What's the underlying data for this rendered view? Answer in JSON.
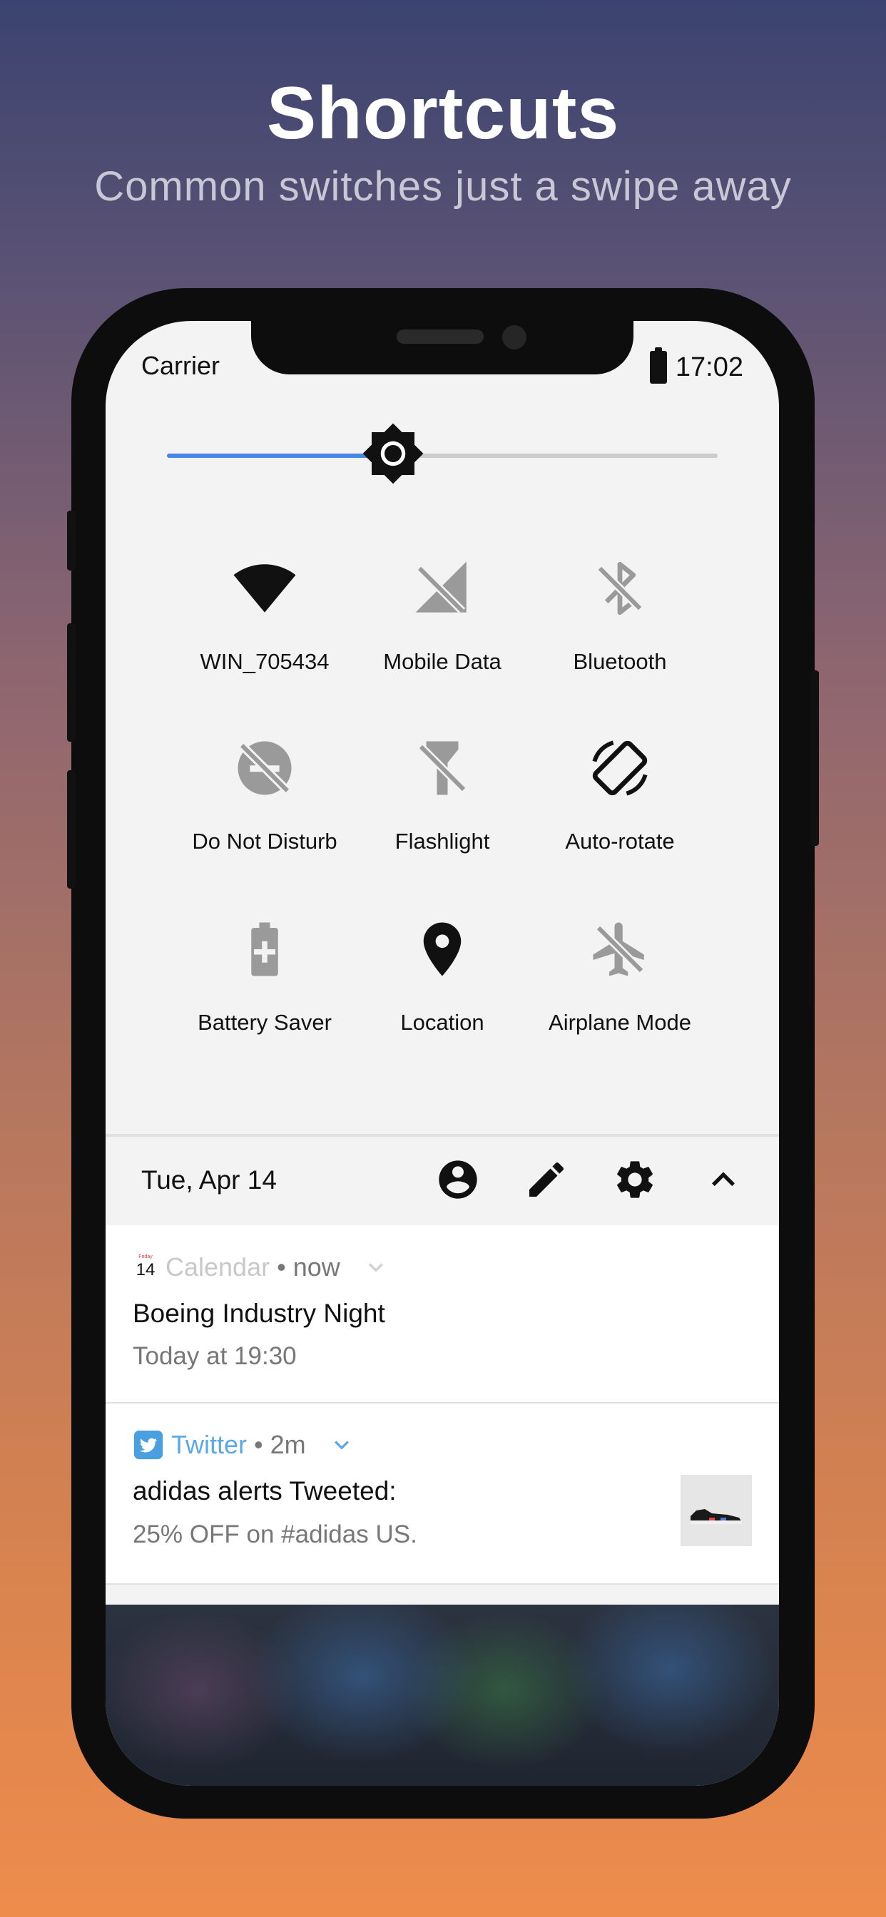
{
  "hero": {
    "title": "Shortcuts",
    "subtitle": "Common switches just a swipe away"
  },
  "status_bar": {
    "carrier": "Carrier",
    "time": "17:02",
    "battery_icon": "battery-full-icon"
  },
  "brightness": {
    "level": 0.41,
    "icon": "brightness-icon",
    "fill_color": "#4a86e8"
  },
  "tiles": [
    {
      "label": "WIN_705434",
      "icon": "wifi-icon",
      "active": true
    },
    {
      "label": "Mobile Data",
      "icon": "mobile-data-off-icon",
      "active": false
    },
    {
      "label": "Bluetooth",
      "icon": "bluetooth-off-icon",
      "active": false
    },
    {
      "label": "Do Not Disturb",
      "icon": "do-not-disturb-off-icon",
      "active": false
    },
    {
      "label": "Flashlight",
      "icon": "flashlight-off-icon",
      "active": false
    },
    {
      "label": "Auto-rotate",
      "icon": "auto-rotate-icon",
      "active": true
    },
    {
      "label": "Battery Saver",
      "icon": "battery-saver-icon",
      "active": false
    },
    {
      "label": "Location",
      "icon": "location-icon",
      "active": true
    },
    {
      "label": "Airplane Mode",
      "icon": "airplane-mode-icon",
      "active": false
    }
  ],
  "toolbar": {
    "date": "Tue, Apr 14",
    "icons": [
      "account-icon",
      "edit-icon",
      "settings-icon",
      "collapse-icon"
    ]
  },
  "notifications": [
    {
      "app": "Calendar",
      "calendar_day": "14",
      "calendar_weekday": "Friday",
      "time": "• now",
      "title": "Boeing Industry Night",
      "body": "Today at 19:30",
      "app_color": "#c8c8c8"
    },
    {
      "app": "Twitter",
      "time": "• 2m",
      "title": "adidas alerts Tweeted:",
      "body": "25% OFF on #adidas US.",
      "app_color": "#5aa9e6",
      "thumbnail": "sneaker-thumbnail"
    }
  ],
  "colors": {
    "active_icon": "#111111",
    "inactive_icon": "#9a9a9a",
    "accent": "#4a86e8"
  }
}
